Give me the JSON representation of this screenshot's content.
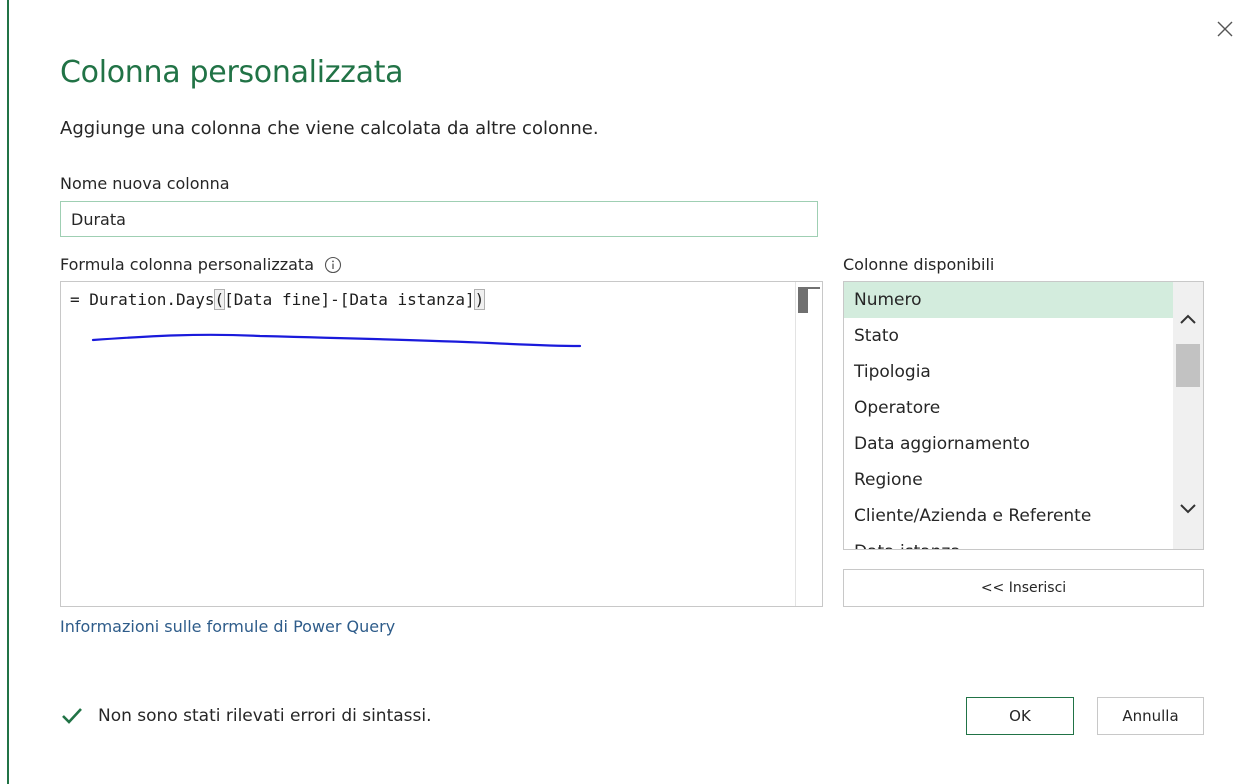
{
  "dialog": {
    "title": "Colonna personalizzata",
    "subtitle": "Aggiunge una colonna che viene calcolata da altre colonne."
  },
  "name_field": {
    "label": "Nome nuova colonna",
    "value": "Durata"
  },
  "formula": {
    "label": "Formula colonna personalizzata",
    "prefix": "= Duration.Days",
    "open_paren": "(",
    "body": "[Data fine]-[Data istanza]",
    "close_paren": ")"
  },
  "available_columns": {
    "label": "Colonne disponibili",
    "items": [
      {
        "label": "Numero",
        "selected": true
      },
      {
        "label": "Stato"
      },
      {
        "label": "Tipologia"
      },
      {
        "label": "Operatore"
      },
      {
        "label": "Data aggiornamento"
      },
      {
        "label": "Regione"
      },
      {
        "label": "Cliente/Azienda e Referente"
      },
      {
        "label": "Data istanza"
      }
    ],
    "insert_button": "<< Inserisci"
  },
  "help_link": "Informazioni sulle formule di Power Query",
  "status": {
    "message": "Non sono stati rilevati errori di sintassi."
  },
  "buttons": {
    "ok": "OK",
    "cancel": "Annulla"
  },
  "colors": {
    "accent": "#217346",
    "selected_bg": "#d3ecdd",
    "link": "#2e5c8a",
    "annotation": "#1a1adb"
  }
}
